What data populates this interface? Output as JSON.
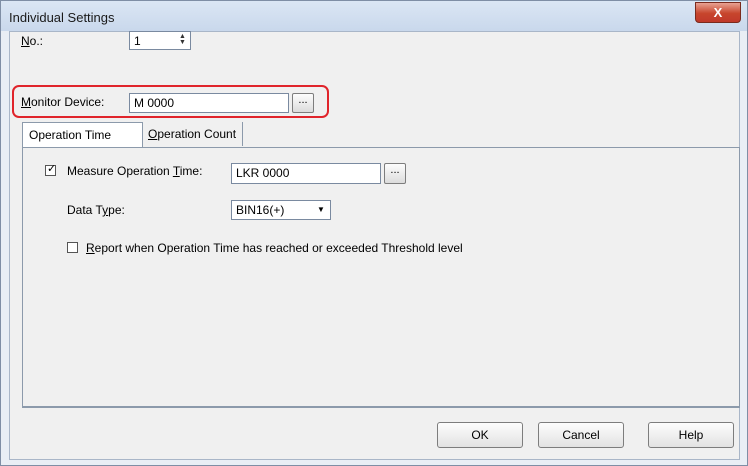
{
  "window": {
    "title": "Individual Settings",
    "close_label": "X"
  },
  "form": {
    "no_label": "No.:",
    "no_value": "1",
    "monitor_label": "Monitor Device:",
    "monitor_value": "M 0000",
    "browse_label": "..."
  },
  "tabs": [
    {
      "label": "Operation Time",
      "active": true
    },
    {
      "label": "Operation Count",
      "active": false
    }
  ],
  "operation_time": {
    "measure_label": "Measure Operation Time:",
    "measure_checked": true,
    "measure_value": "LKR 0000",
    "data_type_label": "Data Type:",
    "data_type_value": "BIN16(+)",
    "report_label": "Report when Operation Time has reached or exceeded Threshold level",
    "report_checked": false
  },
  "buttons": {
    "ok": "OK",
    "cancel": "Cancel",
    "help": "Help"
  },
  "colors": {
    "highlight": "#e0242b",
    "close_button": "#c7452c"
  }
}
